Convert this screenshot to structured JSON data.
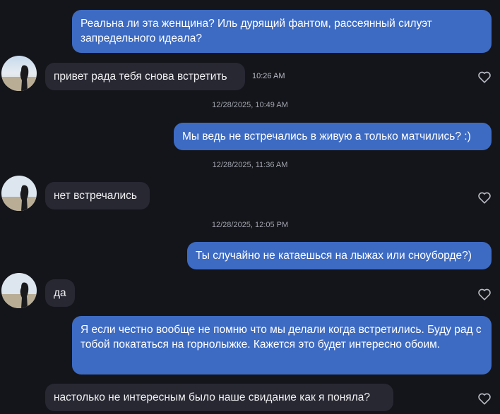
{
  "messages": {
    "m1": {
      "text": "Реальна ли эта женщина? Иль дурящий фантом, рассеянный силуэт запредельного идеала?"
    },
    "m2": {
      "text": "привет рада тебя снова встретить",
      "time": "10:26 AM"
    },
    "sep1": "12/28/2025, 10:49 AM",
    "m3": {
      "text": "Мы ведь не встречались в живую а только матчились? :)"
    },
    "sep2": "12/28/2025, 11:36 AM",
    "m4": {
      "text": "нет встречались"
    },
    "sep3": "12/28/2025, 12:05 PM",
    "m5": {
      "text": "Ты случайно не катаешься на лыжах или сноуборде?)"
    },
    "m6": {
      "text": "да"
    },
    "m7": {
      "text": "Я если честно вообще не помню что мы делали когда встретились. Буду рад с тобой покататься на горнолыжке. Кажется это будет интересно обоим."
    },
    "m8": {
      "text": "настолько не интересным было наше свидание как я поняла?"
    }
  },
  "icons": {
    "like": "heart-outline-icon",
    "avatar": "profile-photo"
  },
  "colors": {
    "background": "#14151a",
    "outgoing_bubble": "#3d6bc3",
    "incoming_bubble": "#272832",
    "timestamp": "#a1a3ad"
  }
}
